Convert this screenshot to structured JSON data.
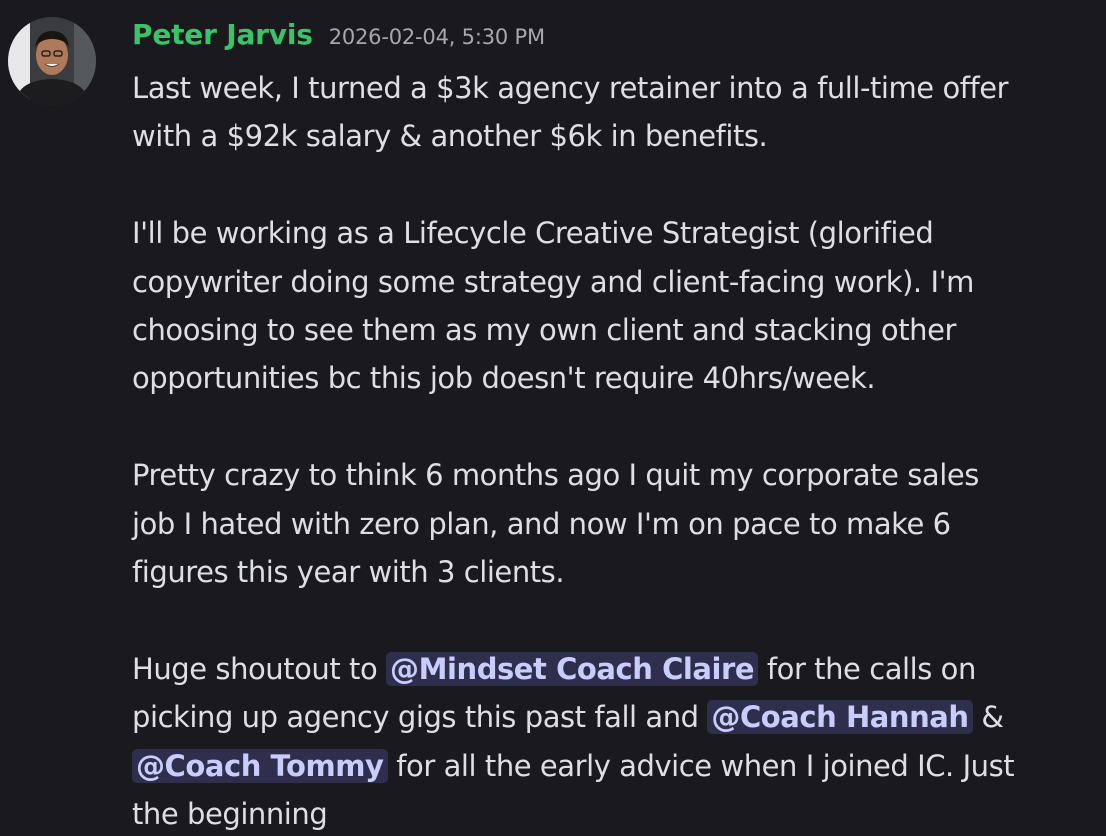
{
  "message": {
    "author": "Peter Jarvis",
    "timestamp": "2026-02-04, 5:30 PM",
    "author_color": "#3ac46a",
    "mention_bg": "#2f2f4d",
    "lines": [
      "Last week, I turned a $3k agency retainer into a full-time offer",
      "with a $92k salary & another $6k in benefits.",
      "I'll be working as a Lifecycle Creative Strategist (glorified",
      "copywriter doing some strategy and client-facing work). I'm",
      "choosing to see them as my own client and stacking other",
      "opportunities bc this job doesn't require 40hrs/week.",
      "Pretty crazy to think 6 months ago I quit my corporate sales",
      "job I hated with zero plan, and now I'm on pace to make 6",
      "figures this year with 3 clients."
    ],
    "shoutout": {
      "line1_prefix": "Huge shoutout to",
      "mention1": "@Mindset Coach Claire",
      "line1_suffix": "for the calls on",
      "line2_prefix": "picking up agency gigs this past fall and",
      "mention2": "@Coach Hannah",
      "line2_suffix": "&",
      "mention3": "@Coach Tommy",
      "line3_suffix": "for all the early advice when I joined IC. Just",
      "line4": "the beginning"
    }
  }
}
